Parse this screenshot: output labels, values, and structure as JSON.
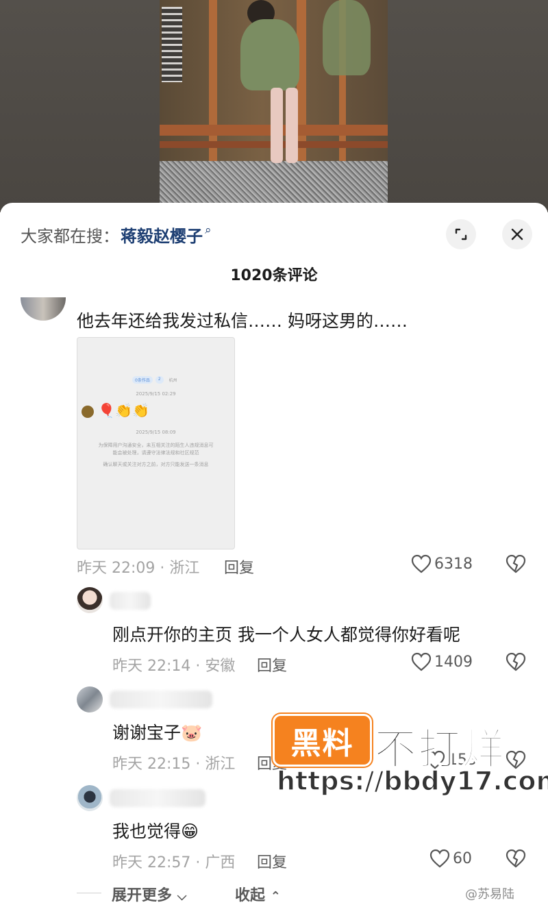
{
  "search": {
    "prefix": "大家都在搜：",
    "term": "蒋毅赵樱子",
    "term_icon": "search-icon"
  },
  "header": {
    "comment_count": "1020条评论",
    "expand_icon": "expand-icon",
    "close_icon": "close-icon"
  },
  "comments": [
    {
      "text": "他去年还给我发过私信…… 妈呀这男的……",
      "meta": "昨天 22:09 · 浙江",
      "reply_label": "回复",
      "likes": "6318",
      "attached_image": {
        "badges": [
          "0条作品",
          "2",
          "杭州"
        ],
        "time1": "2025/9/15 02:29",
        "time2": "2025/9/15 08:09",
        "notice1": "为保障用户沟通安全，未互相关注的陌生人违规消息可能会被处理，请遵守法律法规和社区规范",
        "notice2": "确认聊天或关注对方之前，对方只能发送一条消息",
        "emoji_row": "🎈👏👏"
      }
    },
    {
      "text": "刚点开你的主页 我一个人女人都觉得你好看呢",
      "meta": "昨天 22:14 · 安徽",
      "reply_label": "回复",
      "likes": "1409"
    },
    {
      "text": "谢谢宝子🐷",
      "meta": "昨天 22:15 · 浙江",
      "reply_label": "回复",
      "likes": "153"
    },
    {
      "text": "我也觉得😁",
      "meta": "昨天 22:57 · 广西",
      "reply_label": "回复",
      "likes": "60"
    }
  ],
  "footer": {
    "expand_more": "展开更多",
    "collapse": "收起"
  },
  "watermark": {
    "logo": "黑料",
    "slogan": "不打烊",
    "url": "https://bbdy17.com",
    "weibo_credit": "@苏易陆"
  },
  "colors": {
    "search_term": "#1e3f73",
    "watermark_orange": "#f5821f"
  }
}
